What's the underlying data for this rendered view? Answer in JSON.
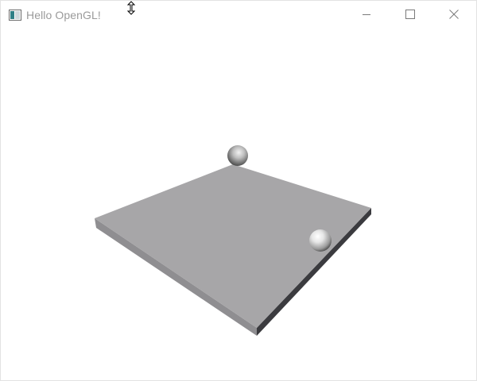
{
  "window": {
    "title": "Hello OpenGL!",
    "controls": {
      "minimize": "minimize-icon",
      "maximize": "maximize-icon",
      "close": "close-icon"
    },
    "app_icon": "app-window-icon",
    "cursor": "vertical-resize-cursor"
  },
  "scene": {
    "background": "#ffffff",
    "platform_top_color": "#a7a6a8",
    "platform_side_color": "#3b3b3f",
    "sphere_color": "#c9c9c9",
    "objects": [
      "platform",
      "sphere",
      "sphere"
    ]
  }
}
